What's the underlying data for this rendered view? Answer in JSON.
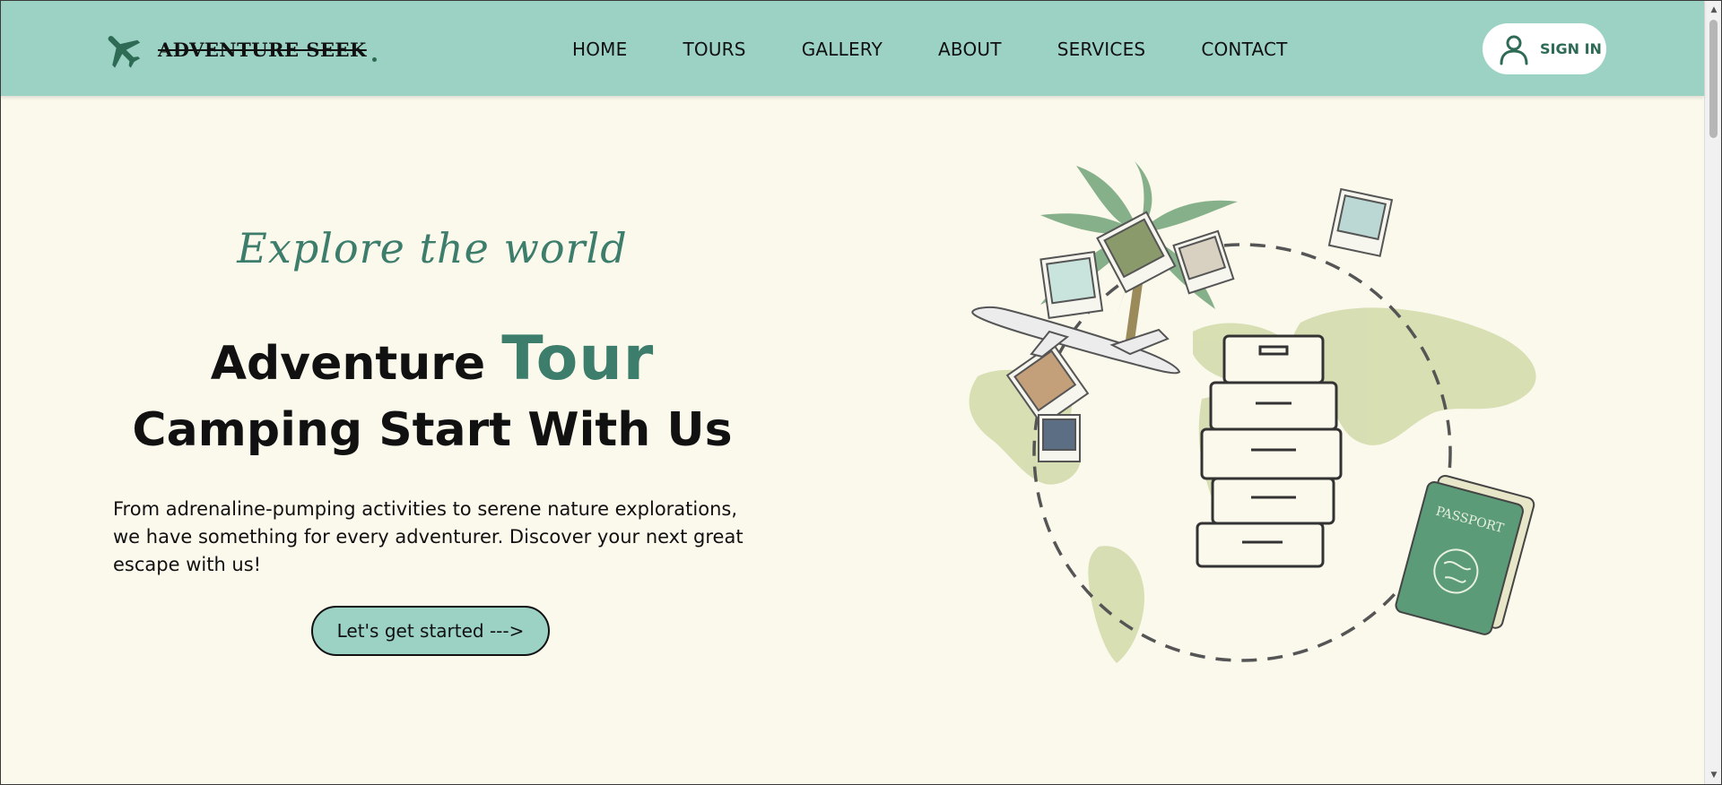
{
  "header": {
    "logo_text": "ADVENTURE SEEK",
    "logo_icon": "airplane-icon",
    "nav": [
      {
        "label": "HOME"
      },
      {
        "label": "TOURS"
      },
      {
        "label": "GALLERY"
      },
      {
        "label": "ABOUT"
      },
      {
        "label": "SERVICES"
      },
      {
        "label": "CONTACT"
      }
    ],
    "signin": {
      "label": "SIGN IN",
      "icon": "user-icon"
    }
  },
  "hero": {
    "tagline": "Explore the world",
    "title_prefix": "Adventure",
    "title_accent": "Tour",
    "title_line2": "Camping Start With Us",
    "description": "From adrenaline-pumping activities to serene nature explorations, we have something for every adventurer. Discover your next great escape with us!",
    "cta": "Let's get started --->"
  },
  "illustration": {
    "passport_label": "PASSPORT"
  },
  "colors": {
    "header_bg": "#9bd2c4",
    "page_bg": "#fbf9ec",
    "accent": "#3d7d6b",
    "logo_green": "#2e6b55",
    "map_green": "#d6ddb0"
  }
}
